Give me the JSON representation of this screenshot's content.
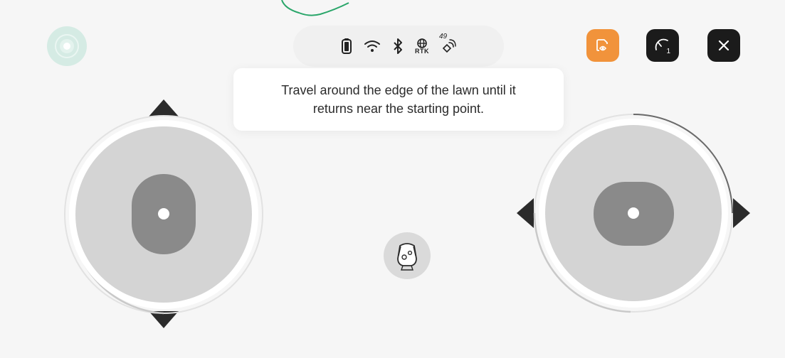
{
  "tooltip": {
    "text": "Travel around the edge of the lawn until it returns near the starting point."
  },
  "status_bar": {
    "battery": "battery-icon",
    "wifi": "wifi-icon",
    "bluetooth": "bluetooth-icon",
    "rtk_label": "RTK",
    "satellite_count": "49"
  },
  "buttons": {
    "locate": "locate-icon",
    "view": "eye-view-icon",
    "speed": "speed-gauge-icon",
    "speed_level": "1",
    "close": "close-icon"
  },
  "colors": {
    "accent_orange": "#f1933b",
    "dark_button": "#1b1b1b",
    "locate_mint": "#d5ebe4",
    "map_path": "#2aa66a",
    "joystick_base": "#d4d4d4",
    "joystick_thumb": "#8a8a8a"
  }
}
